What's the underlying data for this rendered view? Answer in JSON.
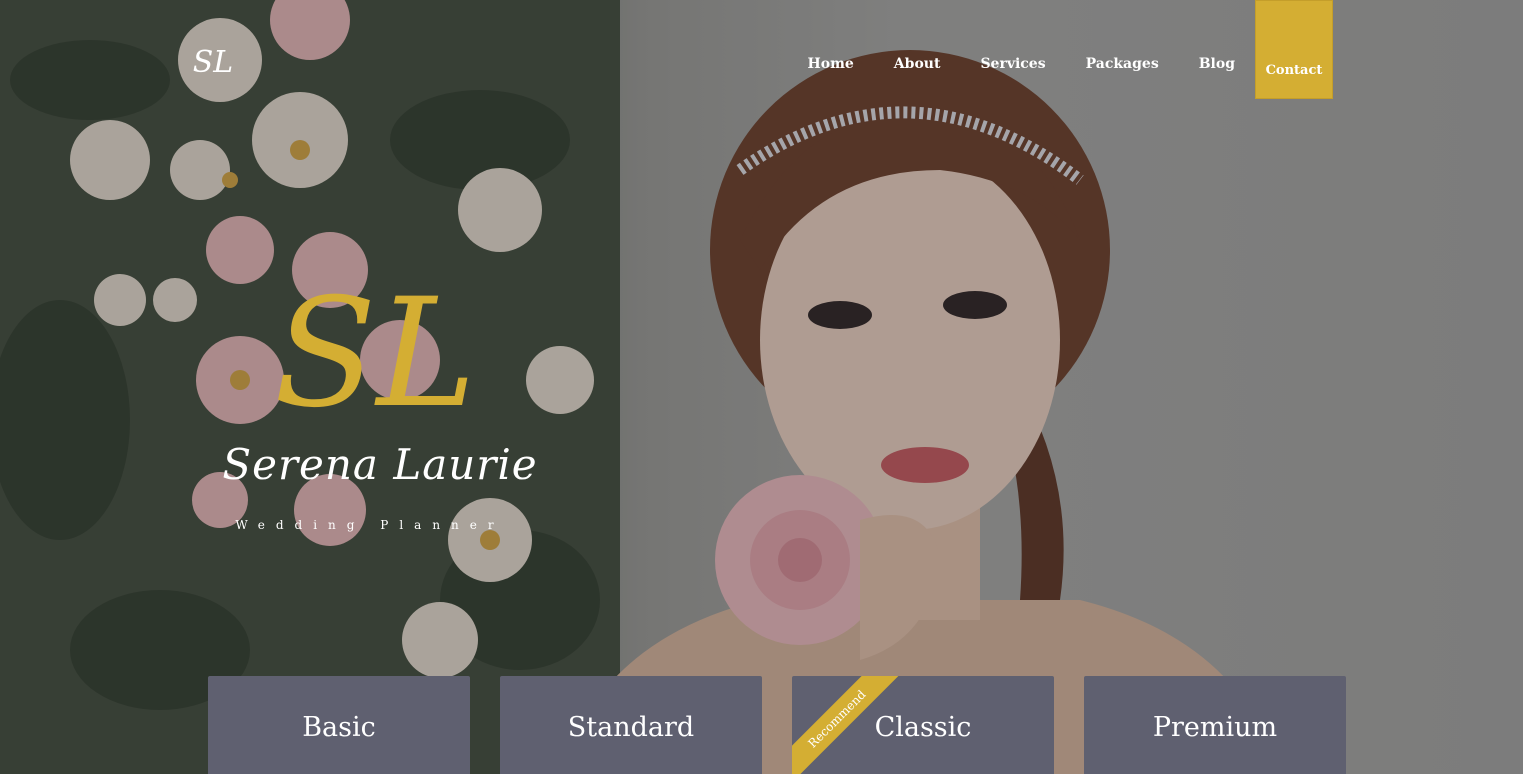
{
  "nav": {
    "items": [
      "Home",
      "About",
      "Services",
      "Packages",
      "Blog"
    ],
    "contact_label": "Contact"
  },
  "brand": {
    "mini_logo": "SL",
    "monogram": "SL",
    "name": "Serena Laurie",
    "tagline": "Wedding Planner"
  },
  "packages": [
    {
      "title": "Basic",
      "ribbon": ""
    },
    {
      "title": "Standard",
      "ribbon": ""
    },
    {
      "title": "Classic",
      "ribbon": "Recommend"
    },
    {
      "title": "Premium",
      "ribbon": ""
    }
  ],
  "colors": {
    "accent": "#d4ae33",
    "card": "#5f6070",
    "text_light": "#ffffff"
  }
}
